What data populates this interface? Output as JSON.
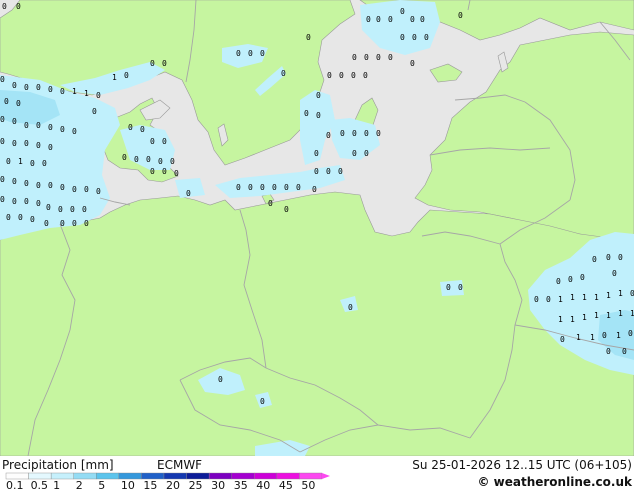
{
  "map": {
    "colors": {
      "land": "#c6f5a0",
      "sea": "#e7e7e7",
      "border": "#a6a6a6",
      "coast": "#999999",
      "precip_light": "#c0f0fc",
      "precip_mid": "#a4e4f6",
      "marker": "#000000"
    },
    "value_labels_visible": [
      "0",
      "1"
    ]
  },
  "legend": {
    "title": "Precipitation [mm]",
    "model": "ECMWF",
    "valid_time": "Su 25-01-2026 12..15 UTC (06+105)",
    "credit": "© weatheronline.co.uk",
    "scale": [
      {
        "label": "0.1",
        "color": "#fdfdfd"
      },
      {
        "label": "0.5",
        "color": "#e4f8fe"
      },
      {
        "label": "1",
        "color": "#c6f0fc"
      },
      {
        "label": "2",
        "color": "#94dcf4"
      },
      {
        "label": "5",
        "color": "#5cc4ec"
      },
      {
        "label": "10",
        "color": "#3498dc"
      },
      {
        "label": "15",
        "color": "#2060c8"
      },
      {
        "label": "20",
        "color": "#1438b0"
      },
      {
        "label": "25",
        "color": "#0c1c98"
      },
      {
        "label": "30",
        "color": "#7c00c0"
      },
      {
        "label": "35",
        "color": "#a400d0"
      },
      {
        "label": "40",
        "color": "#cc00d8"
      },
      {
        "label": "45",
        "color": "#ec10e0"
      },
      {
        "label": "50",
        "color": "#fc48f0"
      }
    ]
  }
}
